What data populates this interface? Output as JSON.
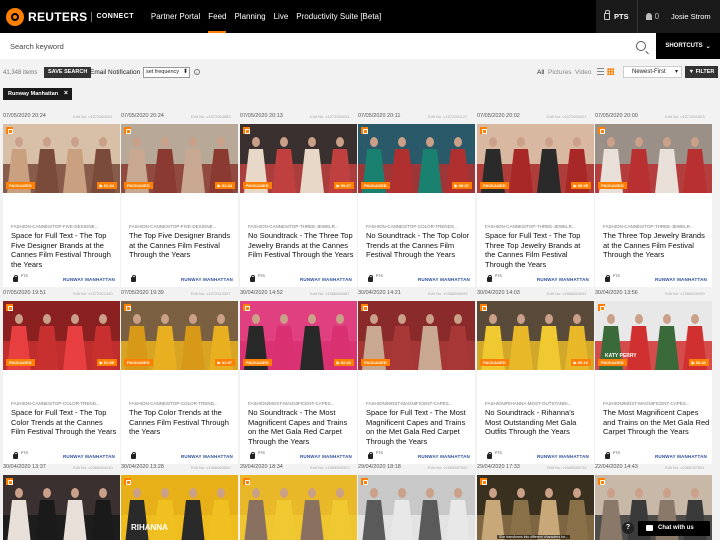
{
  "app": {
    "logo_text": "REUTERS",
    "logo_sub": "CONNECT",
    "nav": [
      "Partner Portal",
      "Feed",
      "Planning",
      "Live",
      "Productivity Suite [Beta]"
    ],
    "active_nav": "Feed",
    "pts_label": "PTS",
    "notifications_count": "0",
    "user_name": "Josie Strom"
  },
  "search": {
    "placeholder": "Search keyword",
    "shortcuts_label": "SHORTCUTS"
  },
  "filters": {
    "item_count": "41,348 items",
    "save_search_label": "SAVE SEARCH",
    "email_notification_label": "Email Notification",
    "frequency_value": "set frequency",
    "type_filters": [
      "All",
      "Pictures",
      "Video"
    ],
    "sort_value": "Newest-First",
    "filter_button_label": "FILTER",
    "active_chip": "Runway Manhattan"
  },
  "colors": {
    "accent": "#ff8000",
    "source_link": "#2a4c9a",
    "nav_bg": "#000000"
  },
  "rows": [
    {
      "cards": [
        {
          "date": "07/05/2020 20:24",
          "edit": "Edit No: v1572964001",
          "slug": "FASHION-CANNES/TOP-FIVE-DESIGNE...",
          "headline": "Space for Full Text - The Top Five Designer Brands at the Cannes Film Festival Through the Years",
          "badge": "PACKAGED",
          "duration": "01:34",
          "pts": "PTS",
          "source": "RUNWAY MANHATTAN",
          "palette": [
            "#7a4a3a",
            "#c9a080",
            "#d8c0a8"
          ]
        },
        {
          "date": "07/05/2020 20:24",
          "edit": "Edit No: v1572963883",
          "slug": "FASHION-CANNES/TOP-FIVE-DESIGNE...",
          "headline": "The Top Five Designer Brands at the Cannes Film Festival Through the Years",
          "badge": "PACKAGED",
          "duration": "01:34",
          "pts": "",
          "source": "RUNWAY MANHATTAN",
          "palette": [
            "#8a3a30",
            "#c8a890",
            "#b8a898"
          ]
        },
        {
          "date": "07/05/2020 20:13",
          "edit": "Edit No: v1572950031",
          "slug": "FASHION-CANNES/TOP-THREE-JEWELR...",
          "headline": "No Soundtrack - The Three Top Jewelry Brands at the Cannes Film Festival Through the Years",
          "badge": "PACKAGED",
          "duration": "00:27",
          "pts": "PTS",
          "source": "RUNWAY MANHATTAN",
          "palette": [
            "#c04040",
            "#e8d8c8",
            "#3a3030"
          ]
        },
        {
          "date": "07/05/2020 20:11",
          "edit": "Edit No: v1572951127",
          "slug": "FASHION-CANNES/TOP-COLOR-TRENDS...",
          "headline": "No Soundtrack - The Top Color Trends at the Cannes Film Festival Through the Years",
          "badge": "PACKAGED",
          "duration": "00:37",
          "pts": "PTS",
          "source": "RUNWAY MANHATTAN",
          "palette": [
            "#b03030",
            "#1a8070",
            "#2a5a6a"
          ]
        },
        {
          "date": "07/05/2020 20:02",
          "edit": "Edit No: v1572950407",
          "slug": "FASHION-CANNES/TOP-THREE-JEWELR...",
          "headline": "Space for Full Text - The Top Three Top Jewelry Brands at the Cannes Film Festival Through the Years",
          "badge": "PACKAGED",
          "duration": "00:35",
          "pts": "PTS",
          "source": "RUNWAY MANHATTAN",
          "palette": [
            "#a82828",
            "#2a2a2a",
            "#d8b8a0"
          ]
        },
        {
          "date": "07/05/2020 20:00",
          "edit": "Edit No: v1572951523",
          "slug": "FASHION-CANNES/TOP-THREE-JEWELR...",
          "headline": "The Three Top Jewelry Brands at the Cannes Film Festival Through the Years",
          "badge": "PACKAGED",
          "duration": "",
          "pts": "PTS",
          "source": "RUNWAY MANHATTAN",
          "palette": [
            "#b83030",
            "#e8e0d8",
            "#9a9088"
          ]
        }
      ]
    },
    {
      "cards": [
        {
          "date": "07/05/2020 19:51",
          "edit": "Edit No: v1572901440",
          "slug": "FASHION-CANNES/TOP-COLOR-TREND...",
          "headline": "Space for Full Text - The Top Color Trends at the Cannes Film Festival Through the Years",
          "badge": "PACKAGED",
          "duration": "01:59",
          "pts": "PTS",
          "source": "RUNWAY MANHATTAN",
          "palette": [
            "#c83030",
            "#e84040",
            "#8a2020"
          ]
        },
        {
          "date": "07/05/2020 19:39",
          "edit": "Edit No: v1572910397",
          "slug": "FASHION-CANNES/TOP-COLOR-TREND...",
          "headline": "The Top Color Trends at the Cannes Film Festival Through the Years",
          "badge": "PACKAGED",
          "duration": "01:57",
          "pts": "",
          "source": "RUNWAY MANHATTAN",
          "palette": [
            "#e8b020",
            "#d89818",
            "#7a6040"
          ]
        },
        {
          "date": "30/04/2020 14:52",
          "edit": "Edit No: v1566664487",
          "slug": "FASHION/MOST-MAGNIFICENT-CAPES...",
          "headline": "No Soundtrack - The Most Magnificent Capes and Trains on the Met Gala Red Carpet Through the Years",
          "badge": "PACKAGED",
          "duration": "02:42",
          "pts": "PTS",
          "source": "RUNWAY MANHATTAN",
          "palette": [
            "#d83070",
            "#282828",
            "#e04080"
          ]
        },
        {
          "date": "30/04/2020 14:21",
          "edit": "Edit No: v1566666955",
          "slug": "FASHION/MOST-MAGNIFICENT-CAPES...",
          "headline": "Space for Full Text - The Most Magnificent Capes and Trains on the Met Gala Red Carpet Through the Years",
          "badge": "PACKAGED",
          "duration": "",
          "pts": "PTS",
          "source": "RUNWAY MANHATTAN",
          "palette": [
            "#a83838",
            "#c8a890",
            "#8a2a2a"
          ]
        },
        {
          "date": "30/04/2020 14:03",
          "edit": "Edit No: v1566664941",
          "slug": "FASHION/RIHANNA-MOST-OUTSTANDI...",
          "headline": "No Soundtrack - Rihanna's Most Outstanding Met Gala Outfits Through the Years",
          "badge": "PACKAGED",
          "duration": "00:19",
          "pts": "PTS",
          "source": "RUNWAY MANHATTAN",
          "palette": [
            "#e8b828",
            "#f0c830",
            "#5a4a3a"
          ]
        },
        {
          "date": "30/04/2020 13:56",
          "edit": "Edit No: v1566659059",
          "slug": "FASHION/MOST-MAGNIFICENT-CAPES...",
          "headline": "The Most Magnificent Capes and Trains on the Met Gala Red Carpet Through the Years",
          "badge": "PACKAGED",
          "duration": "02:42",
          "pts": "PTS",
          "source": "RUNWAY MANHATTAN",
          "palette": [
            "#d03030",
            "#3a6a3a",
            "#e8e8e8"
          ],
          "caption": "KATY PERRY"
        }
      ]
    },
    {
      "cards": [
        {
          "date": "30/04/2020 13:37",
          "edit": "Edit No: v1566664140",
          "palette": [
            "#1a1a1a",
            "#e8e0d8",
            "#3a3030"
          ]
        },
        {
          "date": "30/04/2020 13:28",
          "edit": "Edit No: v1566663562",
          "palette": [
            "#f0c020",
            "#2a2a2a",
            "#e8b018"
          ],
          "caption": "RIHANNA"
        },
        {
          "date": "29/04/2020 18:34",
          "edit": "Edit No: v1565589303",
          "palette": [
            "#f0c830",
            "#8a7060",
            "#e8b828"
          ]
        },
        {
          "date": "29/04/2020 18:18",
          "edit": "Edit No: v1565587850",
          "palette": [
            "#e8e8e8",
            "#5a5a5a",
            "#c8c8c8"
          ]
        },
        {
          "date": "29/04/2020 17:33",
          "edit": "Edit No: v1565585736",
          "palette": [
            "#8a7048",
            "#c8a878",
            "#3a3020"
          ],
          "subtitle": "She transforms into different characters for..."
        },
        {
          "date": "22/04/2020 14:43",
          "edit": "Edit No: v1565287601",
          "palette": [
            "#3a3a3a",
            "#8a7868",
            "#c8b8a8"
          ]
        }
      ]
    }
  ],
  "help_label": "?",
  "chat_label": "Chat with us"
}
